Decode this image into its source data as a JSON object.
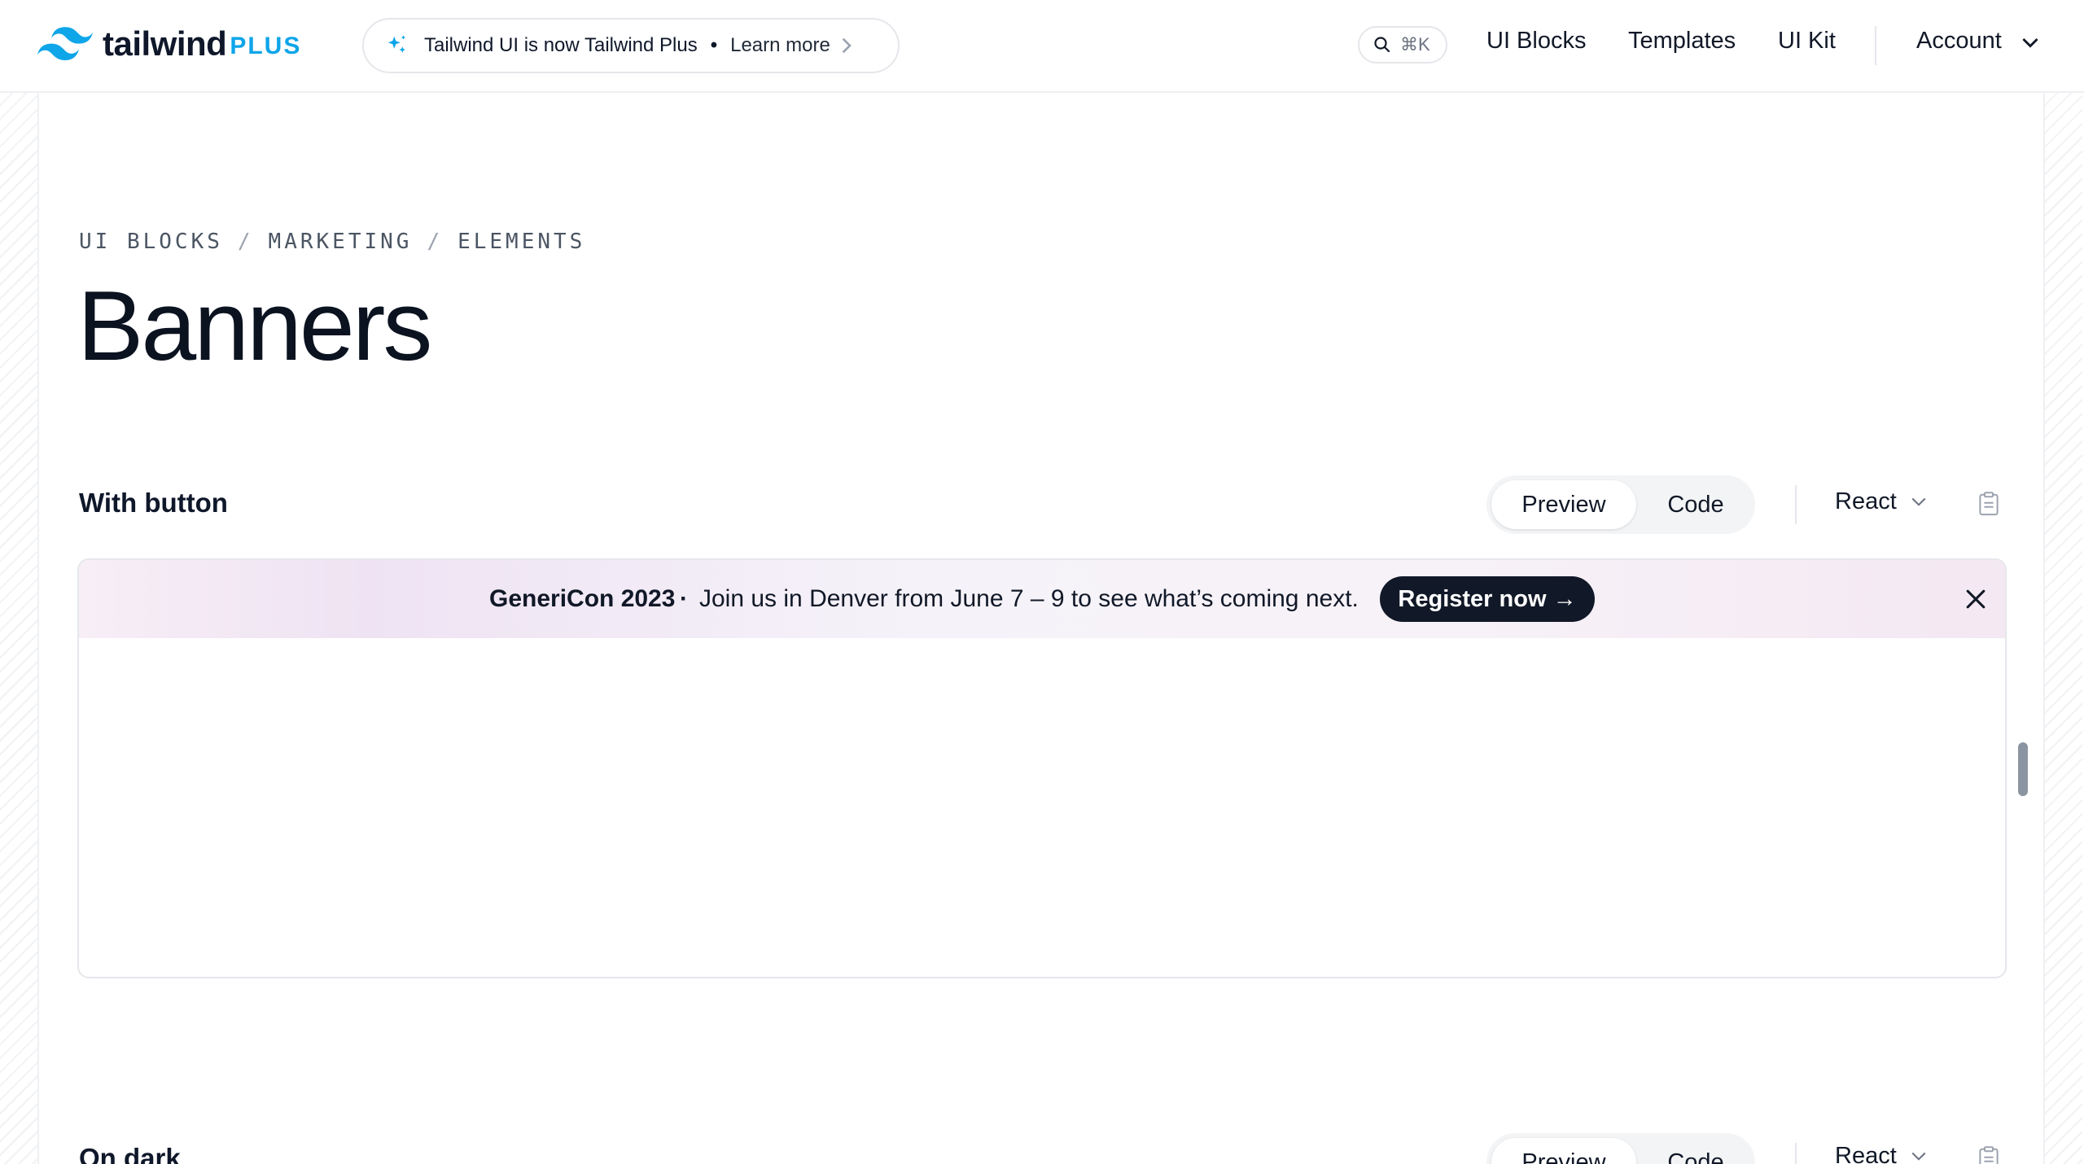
{
  "header": {
    "logo_word": "tailwind",
    "logo_plus": "PLUS",
    "announcement": {
      "text": "Tailwind UI is now Tailwind Plus",
      "separator": "•",
      "link": "Learn more"
    },
    "search": {
      "shortcut": "⌘K"
    },
    "nav": {
      "ui_blocks": "UI Blocks",
      "templates": "Templates",
      "ui_kit": "UI Kit",
      "account": "Account"
    }
  },
  "breadcrumb": {
    "items": [
      "UI BLOCKS",
      "MARKETING",
      "ELEMENTS"
    ],
    "separator": "/"
  },
  "page_title": "Banners",
  "sections": [
    {
      "title": "With button",
      "toggle": {
        "preview": "Preview",
        "code": "Code",
        "selected": "Preview"
      },
      "framework": "React",
      "banner": {
        "name": "GeneriCon 2023",
        "dot": "·",
        "message": "Join us in Denver from June 7 – 9 to see what’s coming next.",
        "cta": "Register now →"
      }
    },
    {
      "title": "On dark",
      "toggle": {
        "preview": "Preview",
        "code": "Code",
        "selected": "Preview"
      },
      "framework": "React"
    }
  ],
  "colors": {
    "brand": "#0ea5e9",
    "text": "#0f172a",
    "cta_bg": "#111827"
  }
}
